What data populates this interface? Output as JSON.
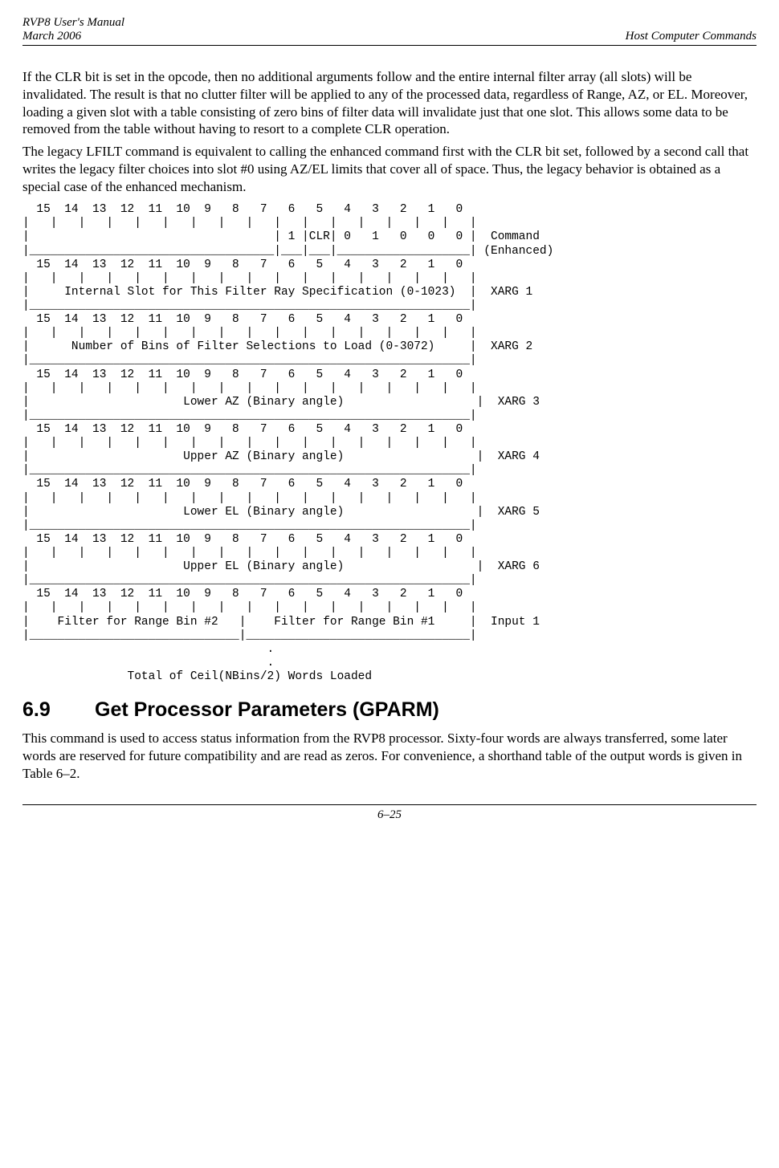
{
  "header": {
    "left_top": "RVP8 User's Manual",
    "left_bottom": "March 2006",
    "right": "Host Computer Commands"
  },
  "para1": "If the CLR bit is set in the opcode, then no additional arguments follow and the entire internal filter array (all slots) will be invalidated.  The result is that no clutter filter will be applied to any of the processed data, regardless of Range, AZ, or EL.  Moreover, loading a given slot with a table consisting of zero bins of filter data will invalidate just that one slot.  This allows some data to be removed from the table without having to resort to a complete CLR operation.",
  "para2": "The legacy LFILT command is equivalent to calling the enhanced command first with the CLR bit set, followed by a second call that writes the legacy filter choices into slot #0 using AZ/EL limits that cover all of space.  Thus, the legacy behavior is obtained as a special case of the enhanced mechanism.",
  "diagram": "  15  14  13  12  11  10  9   8   7   6   5   4   3   2   1   0 \n|   |   |   |   |   |   |   |   |   |   |   |   |   |   |   |   |\n|                                   | 1 |CLR| 0   1   0   0   0 |  Command\n|___________________________________|___|___|___________________| (Enhanced)\n  15  14  13  12  11  10  9   8   7   6   5   4   3   2   1   0 \n|   |   |   |   |   |   |   |   |   |   |   |   |   |   |   |   |\n|     Internal Slot for This Filter Ray Specification (0-1023)  |  XARG 1\n|_______________________________________________________________|\n  15  14  13  12  11  10  9   8   7   6   5   4   3   2   1   0 \n|   |   |   |   |   |   |   |   |   |   |   |   |   |   |   |   |\n|      Number of Bins of Filter Selections to Load (0-3072)     |  XARG 2\n|_______________________________________________________________|\n  15  14  13  12  11  10  9   8   7   6   5   4   3   2   1   0 \n|   |   |   |   |   |   |   |   |   |   |   |   |   |   |   |   |\n|                      Lower AZ (Binary angle)                   |  XARG 3\n|_______________________________________________________________|\n  15  14  13  12  11  10  9   8   7   6   5   4   3   2   1   0 \n|   |   |   |   |   |   |   |   |   |   |   |   |   |   |   |   |\n|                      Upper AZ (Binary angle)                   |  XARG 4\n|_______________________________________________________________|\n  15  14  13  12  11  10  9   8   7   6   5   4   3   2   1   0 \n|   |   |   |   |   |   |   |   |   |   |   |   |   |   |   |   |\n|                      Lower EL (Binary angle)                   |  XARG 5\n|_______________________________________________________________|\n  15  14  13  12  11  10  9   8   7   6   5   4   3   2   1   0 \n|   |   |   |   |   |   |   |   |   |   |   |   |   |   |   |   |\n|                      Upper EL (Binary angle)                   |  XARG 6\n|_______________________________________________________________|\n  15  14  13  12  11  10  9   8   7   6   5   4   3   2   1   0 \n|   |   |   |   |   |   |   |   |   |   |   |   |   |   |   |   |\n|    Filter for Range Bin #2   |    Filter for Range Bin #1     |  Input 1\n|______________________________|________________________________|\n                                   .\n                                   .\n               Total of Ceil(NBins/2) Words Loaded",
  "section": {
    "number": "6.9",
    "title": "Get Processor Parameters (GPARM)"
  },
  "para3": "This command is used to access status information from the RVP8 processor.  Sixty-four words are always transferred, some later words are reserved for future compatibility and are read as zeros.  For convenience, a shorthand table of the output words is given in Table 6–2.",
  "footer": {
    "page": "6–25"
  }
}
